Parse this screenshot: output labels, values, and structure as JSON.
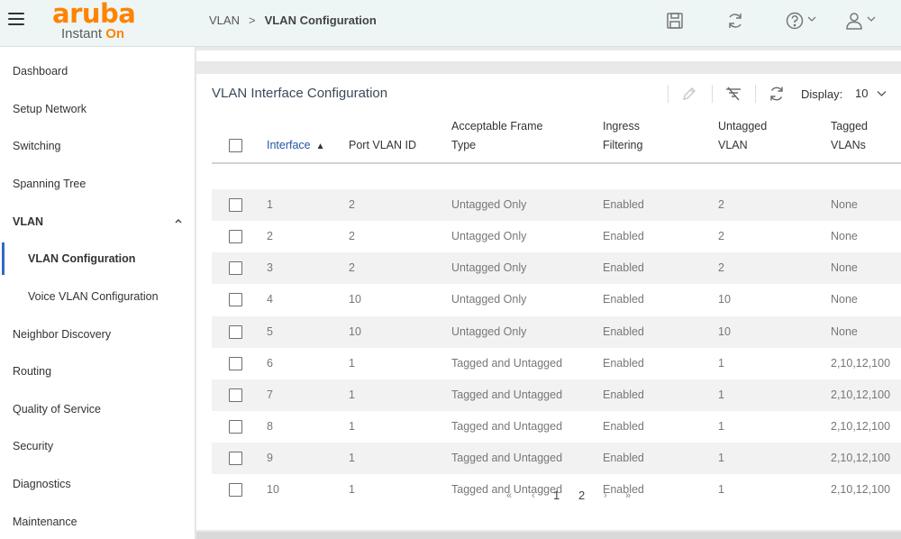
{
  "header": {
    "logo_word": "aruba",
    "logo_sub": "Instant",
    "logo_sub_on": "On",
    "breadcrumb_root": "VLAN",
    "breadcrumb_sep": ">",
    "breadcrumb_current": "VLAN Configuration"
  },
  "sidebar": {
    "items": [
      {
        "label": "Dashboard"
      },
      {
        "label": "Setup Network"
      },
      {
        "label": "Switching"
      },
      {
        "label": "Spanning Tree"
      },
      {
        "label": "VLAN"
      },
      {
        "label": "VLAN Configuration"
      },
      {
        "label": "Voice VLAN Configuration"
      },
      {
        "label": "Neighbor Discovery"
      },
      {
        "label": "Routing"
      },
      {
        "label": "Quality of Service"
      },
      {
        "label": "Security"
      },
      {
        "label": "Diagnostics"
      },
      {
        "label": "Maintenance"
      }
    ]
  },
  "panel": {
    "title": "VLAN Interface Configuration",
    "display_label": "Display:",
    "display_value": "10"
  },
  "table": {
    "headers": {
      "interface": "Interface",
      "sort_indicator": "▲",
      "pvid": "Port VLAN ID",
      "frame_1": "Acceptable Frame",
      "frame_2": "Type",
      "ingress_1": "Ingress",
      "ingress_2": "Filtering",
      "untagged_1": "Untagged",
      "untagged_2": "VLAN",
      "tagged_1": "Tagged",
      "tagged_2": "VLANs"
    },
    "rows": [
      {
        "interface": "1",
        "pvid": "2",
        "frame": "Untagged Only",
        "ingress": "Enabled",
        "untagged": "2",
        "tagged": "None"
      },
      {
        "interface": "2",
        "pvid": "2",
        "frame": "Untagged Only",
        "ingress": "Enabled",
        "untagged": "2",
        "tagged": "None"
      },
      {
        "interface": "3",
        "pvid": "2",
        "frame": "Untagged Only",
        "ingress": "Enabled",
        "untagged": "2",
        "tagged": "None"
      },
      {
        "interface": "4",
        "pvid": "10",
        "frame": "Untagged Only",
        "ingress": "Enabled",
        "untagged": "10",
        "tagged": "None"
      },
      {
        "interface": "5",
        "pvid": "10",
        "frame": "Untagged Only",
        "ingress": "Enabled",
        "untagged": "10",
        "tagged": "None"
      },
      {
        "interface": "6",
        "pvid": "1",
        "frame": "Tagged and Untagged",
        "ingress": "Enabled",
        "untagged": "1",
        "tagged": "2,10,12,100"
      },
      {
        "interface": "7",
        "pvid": "1",
        "frame": "Tagged and Untagged",
        "ingress": "Enabled",
        "untagged": "1",
        "tagged": "2,10,12,100"
      },
      {
        "interface": "8",
        "pvid": "1",
        "frame": "Tagged and Untagged",
        "ingress": "Enabled",
        "untagged": "1",
        "tagged": "2,10,12,100"
      },
      {
        "interface": "9",
        "pvid": "1",
        "frame": "Tagged and Untagged",
        "ingress": "Enabled",
        "untagged": "1",
        "tagged": "2,10,12,100"
      },
      {
        "interface": "10",
        "pvid": "1",
        "frame": "Tagged and Untagged",
        "ingress": "Enabled",
        "untagged": "1",
        "tagged": "2,10,12,100"
      }
    ]
  },
  "pagination": {
    "first": "«",
    "prev": "‹",
    "pages": [
      "1",
      "2"
    ],
    "next": "›",
    "last": "»"
  },
  "icons": {
    "menu": "hamburger-icon",
    "save": "save-icon",
    "refresh": "refresh-icon",
    "help": "help-icon",
    "user": "user-icon",
    "edit": "pencil-icon",
    "clear_filter": "clear-filter-icon",
    "panel_refresh": "refresh-icon"
  },
  "colors": {
    "brand_orange": "#ff8300",
    "header_bg": "#eef6f5",
    "accent_blue": "#3366cc",
    "link_blue": "#2454a6",
    "row_alt": "#f2f2f2"
  }
}
